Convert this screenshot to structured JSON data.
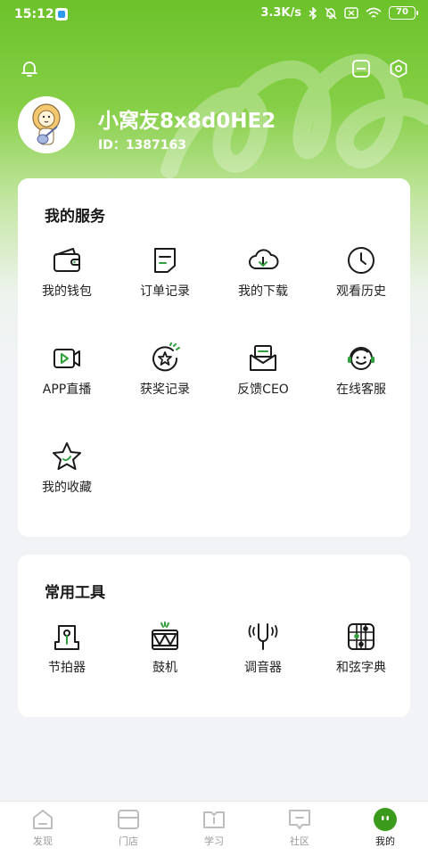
{
  "status_bar": {
    "time": "15:12",
    "net_speed": "3.3K/s",
    "battery": "70"
  },
  "profile": {
    "username": "小窝友8x8d0HE2",
    "user_id": "ID：1387163",
    "avatar_icon": "lion-guitar-avatar"
  },
  "top_actions": {
    "left_icon": "bell-icon",
    "right_icons": [
      "scan-icon",
      "settings-hexagon-icon"
    ]
  },
  "services": {
    "title": "我的服务",
    "items": [
      {
        "label": "我的钱包",
        "icon": "wallet-icon"
      },
      {
        "label": "订单记录",
        "icon": "order-icon"
      },
      {
        "label": "我的下载",
        "icon": "cloud-download-icon"
      },
      {
        "label": "观看历史",
        "icon": "clock-icon"
      },
      {
        "label": "APP直播",
        "icon": "video-icon"
      },
      {
        "label": "获奖记录",
        "icon": "award-icon"
      },
      {
        "label": "反馈CEO",
        "icon": "mail-icon"
      },
      {
        "label": "在线客服",
        "icon": "headset-icon"
      },
      {
        "label": "我的收藏",
        "icon": "star-icon"
      }
    ]
  },
  "tools": {
    "title": "常用工具",
    "items": [
      {
        "label": "节拍器",
        "icon": "metronome-icon"
      },
      {
        "label": "鼓机",
        "icon": "drum-icon"
      },
      {
        "label": "调音器",
        "icon": "tuning-fork-icon"
      },
      {
        "label": "和弦字典",
        "icon": "chord-grid-icon"
      }
    ]
  },
  "tabbar": {
    "tabs": [
      {
        "label": "发现",
        "icon": "discover-icon"
      },
      {
        "label": "门店",
        "icon": "store-icon"
      },
      {
        "label": "学习",
        "icon": "book-icon"
      },
      {
        "label": "社区",
        "icon": "community-icon"
      },
      {
        "label": "我的",
        "icon": "me-icon",
        "active": true
      }
    ]
  },
  "colors": {
    "accent_green": "#6cc22a",
    "active_tab_green": "#3a9a1c",
    "text_dark": "#1a1a1a",
    "tab_inactive": "#9a9a9a"
  }
}
